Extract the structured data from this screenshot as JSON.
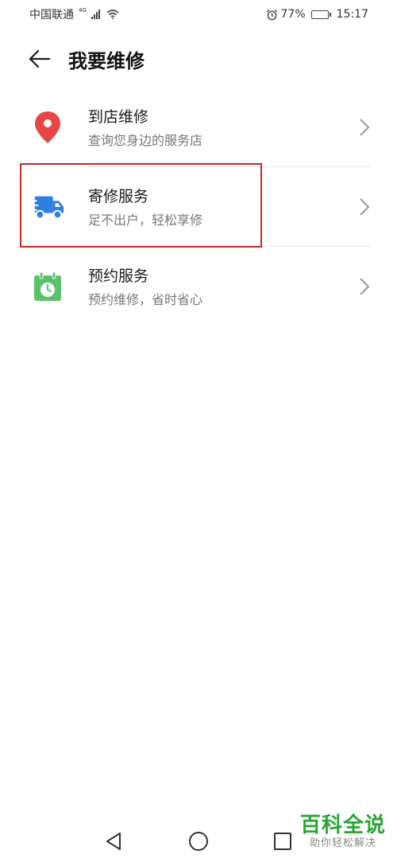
{
  "status_bar": {
    "carrier": "中国联通",
    "network_type": "4G",
    "battery_percent": "77%",
    "battery_level": 0.77,
    "time": "15:17"
  },
  "header": {
    "title": "我要维修",
    "back_icon": "arrow-left-icon"
  },
  "items": [
    {
      "title": "到店维修",
      "subtitle": "查询您身边的服务店",
      "icon": "location-pin-icon",
      "color": "#e84545"
    },
    {
      "title": "寄修服务",
      "subtitle": "足不出户，轻松享修",
      "icon": "delivery-truck-icon",
      "color": "#2e7fe0"
    },
    {
      "title": "预约服务",
      "subtitle": "预约维修，省时省心",
      "icon": "calendar-clock-icon",
      "color": "#5bc26b"
    }
  ],
  "colors": {
    "highlight": "#c6292b",
    "divider": "#e5e5e5",
    "watermark": "#2aa535"
  },
  "watermark": {
    "logo": "百科全说",
    "sub": "助你轻松解决"
  }
}
